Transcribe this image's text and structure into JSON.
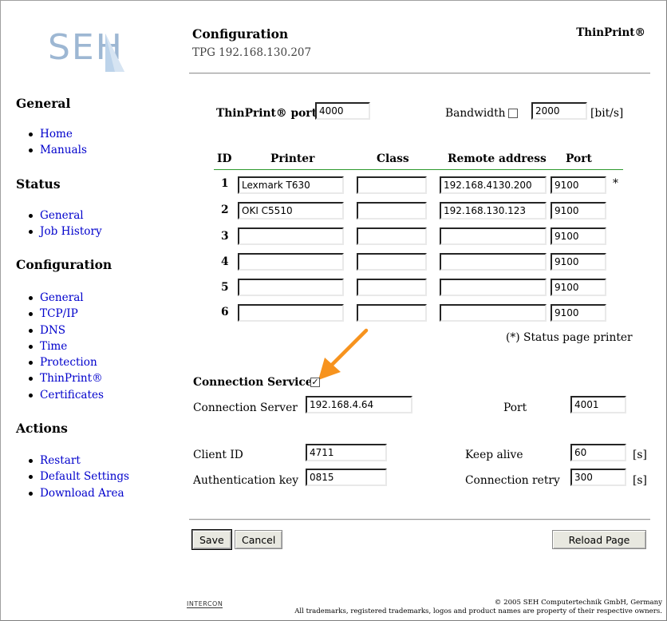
{
  "header": {
    "title": "Configuration",
    "subtitle": "TPG 192.168.130.207",
    "product": "ThinPrint®"
  },
  "logo": {
    "text": "SEH"
  },
  "sidebar": {
    "sections": [
      {
        "heading": "General",
        "items": [
          "Home",
          "Manuals"
        ]
      },
      {
        "heading": "Status",
        "items": [
          "General",
          "Job History"
        ]
      },
      {
        "heading": "Configuration",
        "items": [
          "General",
          "TCP/IP",
          "DNS",
          "Time",
          "Protection",
          "ThinPrint®",
          "Certificates"
        ]
      },
      {
        "heading": "Actions",
        "items": [
          "Restart",
          "Default Settings",
          "Download Area"
        ]
      }
    ]
  },
  "thinprint": {
    "port_label": "ThinPrint® port",
    "port_value": "4000",
    "bandwidth_label": "Bandwidth",
    "bandwidth_checked": false,
    "bandwidth_value": "2000",
    "bandwidth_unit": "[bit/s]"
  },
  "printer_table": {
    "headers": {
      "id": "ID",
      "printer": "Printer",
      "class": "Class",
      "remote": "Remote address",
      "port": "Port"
    },
    "rows": [
      {
        "id": "1",
        "printer": "Lexmark T630",
        "class": "",
        "remote": "192.168.4130.200",
        "port": "9100",
        "mark": "*"
      },
      {
        "id": "2",
        "printer": "OKI C5510",
        "class": "",
        "remote": "192.168.130.123",
        "port": "9100",
        "mark": ""
      },
      {
        "id": "3",
        "printer": "",
        "class": "",
        "remote": "",
        "port": "9100",
        "mark": ""
      },
      {
        "id": "4",
        "printer": "",
        "class": "",
        "remote": "",
        "port": "9100",
        "mark": ""
      },
      {
        "id": "5",
        "printer": "",
        "class": "",
        "remote": "",
        "port": "9100",
        "mark": ""
      },
      {
        "id": "6",
        "printer": "",
        "class": "",
        "remote": "",
        "port": "9100",
        "mark": ""
      }
    ],
    "note": "(*) Status page printer"
  },
  "connection": {
    "service_label": "Connection Service",
    "service_checked": true,
    "server_label": "Connection Server",
    "server_value": "192.168.4.64",
    "port_label": "Port",
    "port_value": "4001",
    "client_id_label": "Client ID",
    "client_id_value": "4711",
    "auth_key_label": "Authentication key",
    "auth_key_value": "0815",
    "keep_alive_label": "Keep alive",
    "keep_alive_value": "60",
    "keep_alive_unit": "[s]",
    "retry_label": "Connection retry",
    "retry_value": "300",
    "retry_unit": "[s]"
  },
  "buttons": {
    "save": "Save",
    "cancel": "Cancel",
    "reload": "Reload Page"
  },
  "annotation": {
    "arrow_color": "#f7931e",
    "icon": "arrow-pointer-icon"
  },
  "footer": {
    "logo": "INTERCON",
    "copyright": "© 2005 SEH Computertechnik GmbH, Germany",
    "trademarks": "All trademarks, registered trademarks, logos and product names are property of their respective owners."
  }
}
